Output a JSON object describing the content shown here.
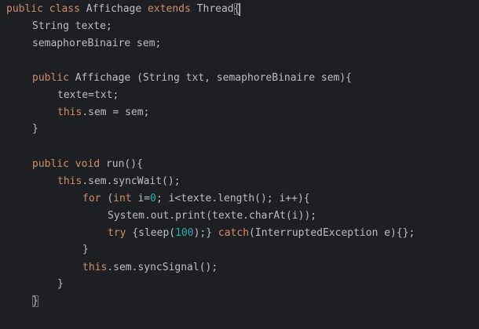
{
  "theme": {
    "background": "#1e1f22",
    "keyword_color": "#cf8e6d",
    "number_color": "#2aacb8",
    "text_color": "#bcbec4"
  },
  "code": {
    "l1": {
      "kw1": "public",
      "kw2": "class",
      "name": "Affichage",
      "kw3": "extends",
      "parent": "Thread",
      "brace": "{"
    },
    "l2": {
      "text": "String texte;"
    },
    "l3": {
      "text": "semaphoreBinaire sem;"
    },
    "l5": {
      "kw": "public",
      "text": "Affichage (String txt, semaphoreBinaire sem){"
    },
    "l6": {
      "text": "texte=txt;"
    },
    "l7": {
      "kw": "this",
      "text": ".sem = sem;"
    },
    "l8": {
      "text": "}"
    },
    "l10": {
      "kw1": "public",
      "kw2": "void",
      "text": "run(){"
    },
    "l11": {
      "kw": "this",
      "text": ".sem.syncWait();"
    },
    "l12": {
      "kw1": "for",
      "t1": "(",
      "kw2": "int",
      "t2": "i=",
      "num": "0",
      "t3": "; i<texte.length(); i++){"
    },
    "l13": {
      "text": "System.out.print(texte.charAt(i));"
    },
    "l14": {
      "kw1": "try",
      "t1": "{sleep(",
      "num": "100",
      "t2": ");}",
      "kw2": "catch",
      "t3": "(InterruptedException e){};"
    },
    "l15": {
      "text": "}"
    },
    "l16": {
      "kw": "this",
      "text": ".sem.syncSignal();"
    },
    "l17": {
      "text": "}"
    },
    "l18": {
      "brace": "}"
    }
  }
}
